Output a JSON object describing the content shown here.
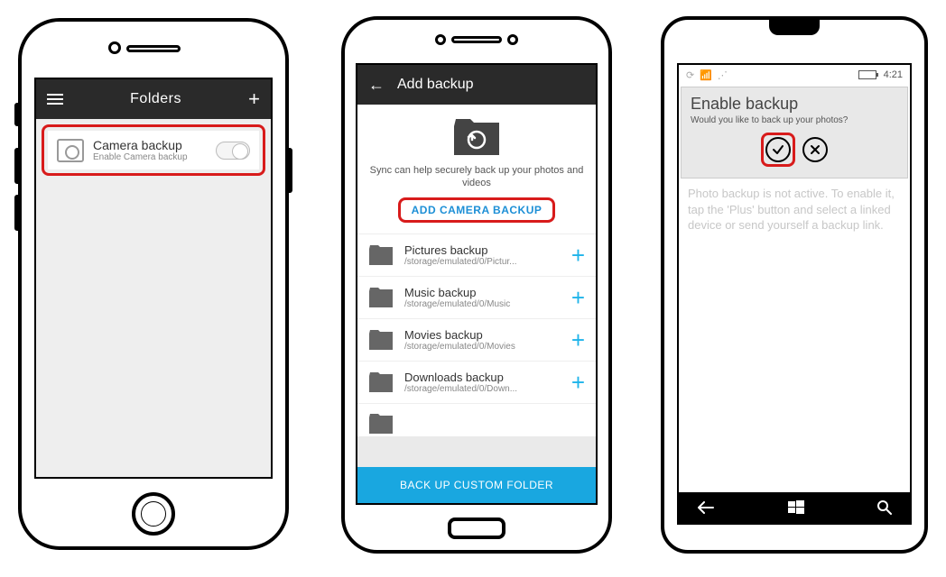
{
  "ios": {
    "header_title": "Folders",
    "item_title": "Camera backup",
    "item_subtitle": "Enable Camera backup"
  },
  "android": {
    "header_title": "Add backup",
    "hero_text_line1": "Sync can help securely back up your photos and",
    "hero_text_line2": "videos",
    "add_camera_label": "ADD CAMERA BACKUP",
    "rows": [
      {
        "title": "Pictures backup",
        "sub": "/storage/emulated/0/Pictur..."
      },
      {
        "title": "Music backup",
        "sub": "/storage/emulated/0/Music"
      },
      {
        "title": "Movies backup",
        "sub": "/storage/emulated/0/Movies"
      },
      {
        "title": "Downloads backup",
        "sub": "/storage/emulated/0/Down..."
      }
    ],
    "footer_label": "BACK UP CUSTOM FOLDER"
  },
  "windows": {
    "status_time": "4:21",
    "card_title": "Enable backup",
    "card_sub": "Would you like to back up your photos?",
    "body_text": "Photo backup is not active. To enable it, tap the 'Plus' button and select a linked device or send yourself a backup link."
  }
}
